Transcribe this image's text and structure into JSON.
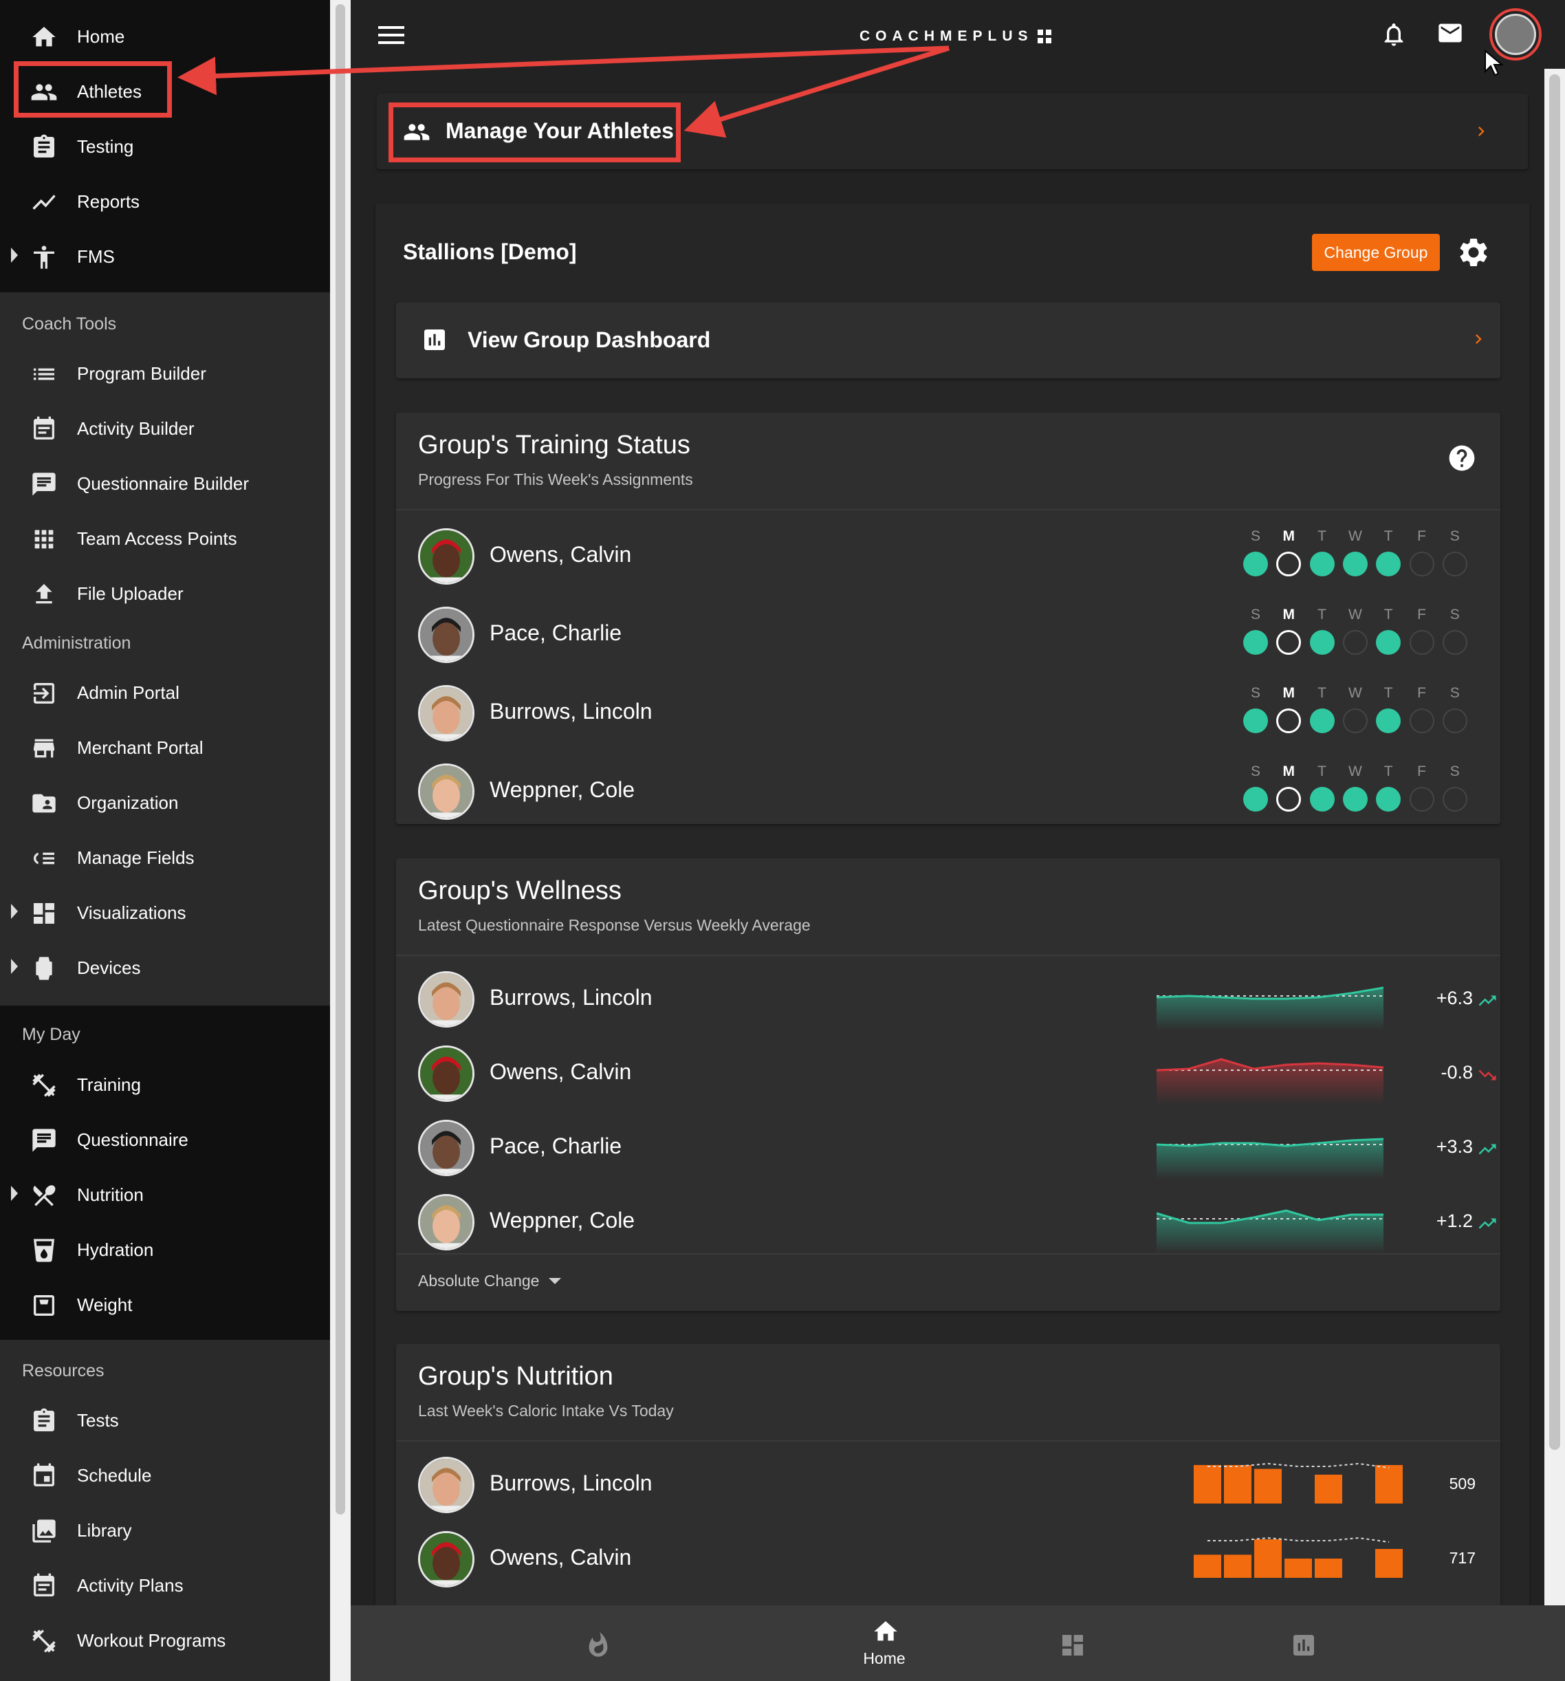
{
  "sidebar": {
    "top_items": [
      {
        "label": "Home",
        "icon": "home-icon"
      },
      {
        "label": "Athletes",
        "icon": "people-icon"
      },
      {
        "label": "Testing",
        "icon": "clipboard-icon"
      },
      {
        "label": "Reports",
        "icon": "trend-line-icon"
      },
      {
        "label": "FMS",
        "icon": "figure-icon"
      }
    ],
    "coach_tools": {
      "heading": "Coach Tools",
      "items": [
        {
          "label": "Program Builder",
          "icon": "list-icon"
        },
        {
          "label": "Activity Builder",
          "icon": "calendar-note-icon"
        },
        {
          "label": "Questionnaire Builder",
          "icon": "message-icon"
        },
        {
          "label": "Team Access Points",
          "icon": "grid-icon"
        },
        {
          "label": "File Uploader",
          "icon": "upload-icon"
        }
      ]
    },
    "administration": {
      "heading": "Administration",
      "items": [
        {
          "label": "Admin Portal",
          "icon": "login-icon"
        },
        {
          "label": "Merchant Portal",
          "icon": "store-icon"
        },
        {
          "label": "Organization",
          "icon": "folder-person-icon"
        },
        {
          "label": "Manage Fields",
          "icon": "fields-icon"
        },
        {
          "label": "Visualizations",
          "icon": "dashboard-icon"
        },
        {
          "label": "Devices",
          "icon": "watch-icon"
        }
      ]
    },
    "my_day": {
      "heading": "My Day",
      "items": [
        {
          "label": "Training",
          "icon": "dumbbell-icon"
        },
        {
          "label": "Questionnaire",
          "icon": "message-icon"
        },
        {
          "label": "Nutrition",
          "icon": "utensils-icon"
        },
        {
          "label": "Hydration",
          "icon": "cup-icon"
        },
        {
          "label": "Weight",
          "icon": "scale-icon"
        }
      ]
    },
    "resources": {
      "heading": "Resources",
      "items": [
        {
          "label": "Tests",
          "icon": "clipboard-icon"
        },
        {
          "label": "Schedule",
          "icon": "calendar-icon"
        },
        {
          "label": "Library",
          "icon": "image-library-icon"
        },
        {
          "label": "Activity Plans",
          "icon": "calendar-note-icon"
        },
        {
          "label": "Workout Programs",
          "icon": "dumbbell-icon"
        }
      ]
    }
  },
  "header": {
    "logo_text": "COACHMEPLUS"
  },
  "manage_athletes": {
    "label": "Manage Your Athletes"
  },
  "group": {
    "name": "Stallions [Demo]",
    "change_group_label": "Change Group",
    "dashboard_label": "View Group Dashboard"
  },
  "training_status": {
    "title": "Group's Training Status",
    "subtitle": "Progress For This Week's Assignments",
    "days": [
      "S",
      "M",
      "T",
      "W",
      "T",
      "F",
      "S"
    ],
    "current_day_index": 1,
    "athletes": [
      {
        "name": "Owens, Calvin",
        "days": [
          "done",
          "today",
          "done",
          "done",
          "done",
          "empty",
          "empty"
        ]
      },
      {
        "name": "Pace, Charlie",
        "days": [
          "done",
          "today",
          "done",
          "empty",
          "done",
          "empty",
          "empty"
        ]
      },
      {
        "name": "Burrows, Lincoln",
        "days": [
          "done",
          "today",
          "done",
          "empty",
          "done",
          "empty",
          "empty"
        ]
      },
      {
        "name": "Weppner, Cole",
        "days": [
          "done",
          "today",
          "done",
          "done",
          "done",
          "empty",
          "empty"
        ]
      }
    ]
  },
  "wellness": {
    "title": "Group's Wellness",
    "subtitle": "Latest Questionnaire Response Versus Weekly Average",
    "footer_label": "Absolute Change",
    "athletes": [
      {
        "name": "Burrows, Lincoln",
        "change": "+6.3",
        "trend": "up"
      },
      {
        "name": "Owens, Calvin",
        "change": "-0.8",
        "trend": "down"
      },
      {
        "name": "Pace, Charlie",
        "change": "+3.3",
        "trend": "up"
      },
      {
        "name": "Weppner, Cole",
        "change": "+1.2",
        "trend": "up"
      }
    ]
  },
  "nutrition": {
    "title": "Group's Nutrition",
    "subtitle": "Last Week's Caloric Intake Vs Today",
    "athletes": [
      {
        "name": "Burrows, Lincoln",
        "value": "509"
      },
      {
        "name": "Owens, Calvin",
        "value": "717"
      }
    ]
  },
  "bottom_nav": {
    "home_label": "Home"
  },
  "colors": {
    "accent": "#f26b0f",
    "teal": "#30c8a0",
    "red": "#d9363e",
    "annotation": "#e8423c"
  }
}
